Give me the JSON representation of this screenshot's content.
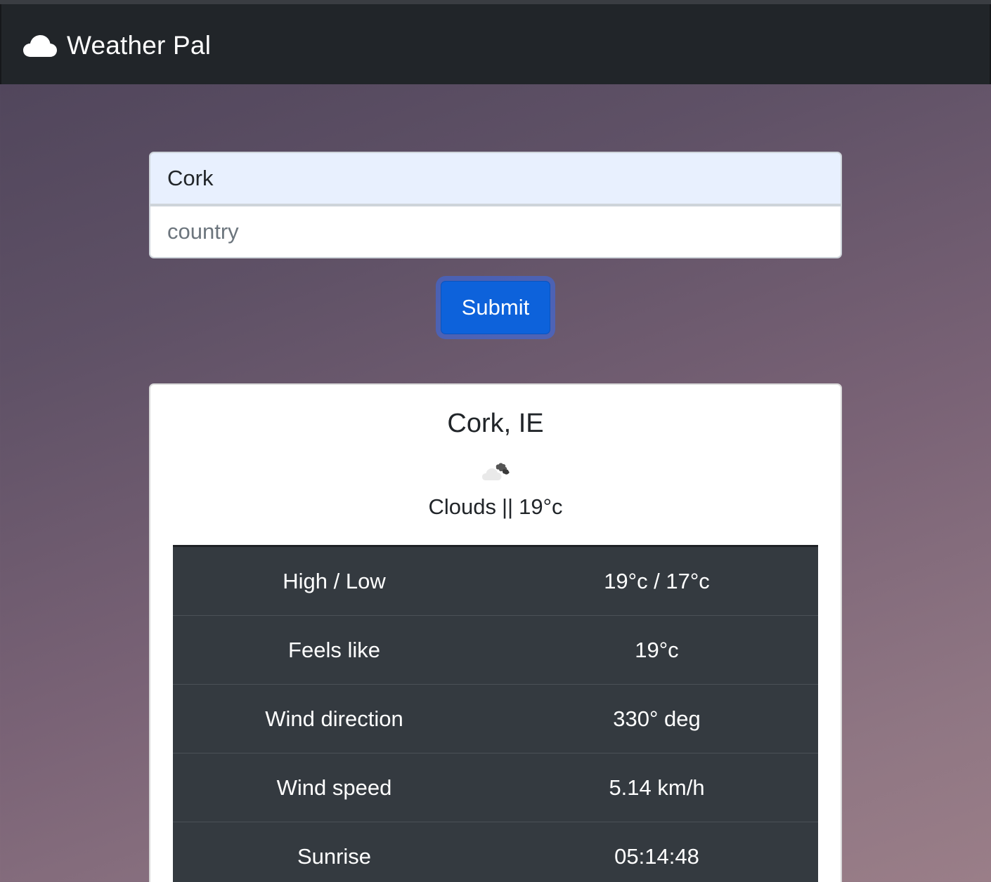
{
  "navbar": {
    "brand_name": "Weather Pal",
    "brand_icon": "cloud-icon"
  },
  "search": {
    "city_value": "Cork",
    "country_value": "",
    "country_placeholder": "country",
    "submit_label": "Submit"
  },
  "result": {
    "location": "Cork, IE",
    "weather_icon": "broken-clouds-icon",
    "condition": "Clouds",
    "separator": "||",
    "temperature": "19°c",
    "rows": [
      {
        "label": "High / Low",
        "value": "19°c / 17°c"
      },
      {
        "label": "Feels like",
        "value": "19°c"
      },
      {
        "label": "Wind direction",
        "value": "330° deg"
      },
      {
        "label": "Wind speed",
        "value": "5.14 km/h"
      },
      {
        "label": "Sunrise",
        "value": "05:14:48"
      }
    ]
  },
  "colors": {
    "navbar": "#212529",
    "submit_button": "#0d62db",
    "table_background": "#343a40"
  }
}
